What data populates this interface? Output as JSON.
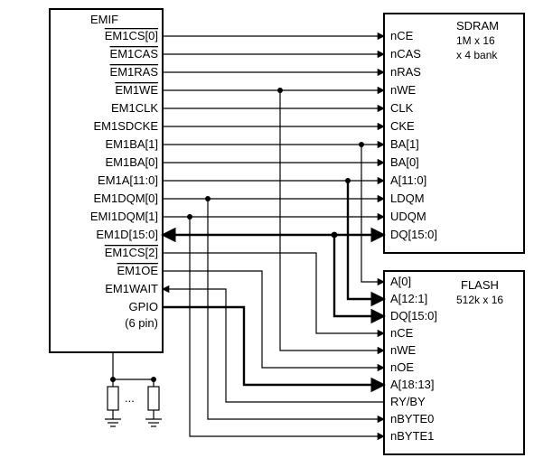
{
  "emif": {
    "title": "EMIF",
    "pins": {
      "cs0": "EM1CS[0]",
      "cas": "EM1CAS",
      "ras": "EM1RAS",
      "we": "EM1WE",
      "clk": "EM1CLK",
      "sdcke": "EM1SDCKE",
      "ba1": "EM1BA[1]",
      "ba0": "EM1BA[0]",
      "a": "EM1A[11:0]",
      "dqm0": "EM1DQM[0]",
      "dqm1": "EMI1DQM[1]",
      "d": "EM1D[15:0]",
      "cs2": "EM1CS[2]",
      "oe": "EM1OE",
      "wait": "EM1WAIT",
      "gpio": "GPIO",
      "gpion": "(6 pin)"
    }
  },
  "sdram": {
    "title": "SDRAM",
    "subtitle1": "1M x 16",
    "subtitle2": "x 4 bank",
    "pins": {
      "nce": "nCE",
      "ncas": "nCAS",
      "nras": "nRAS",
      "nwe": "nWE",
      "clk": "CLK",
      "cke": "CKE",
      "ba1": "BA[1]",
      "ba0": "BA[0]",
      "a": "A[11:0]",
      "ldqm": "LDQM",
      "udqm": "UDQM",
      "dq": "DQ[15:0]"
    }
  },
  "flash": {
    "title": "FLASH",
    "subtitle": "512k x 16",
    "pins": {
      "a0": "A[0]",
      "a12": "A[12:1]",
      "dq": "DQ[15:0]",
      "nce": "nCE",
      "nwe": "nWE",
      "noe": "nOE",
      "a18": "A[18:13]",
      "ryby": "RY/BY",
      "nb0": "nBYTE0",
      "nb1": "nBYTE1"
    }
  },
  "misc": {
    "dots": "..."
  }
}
